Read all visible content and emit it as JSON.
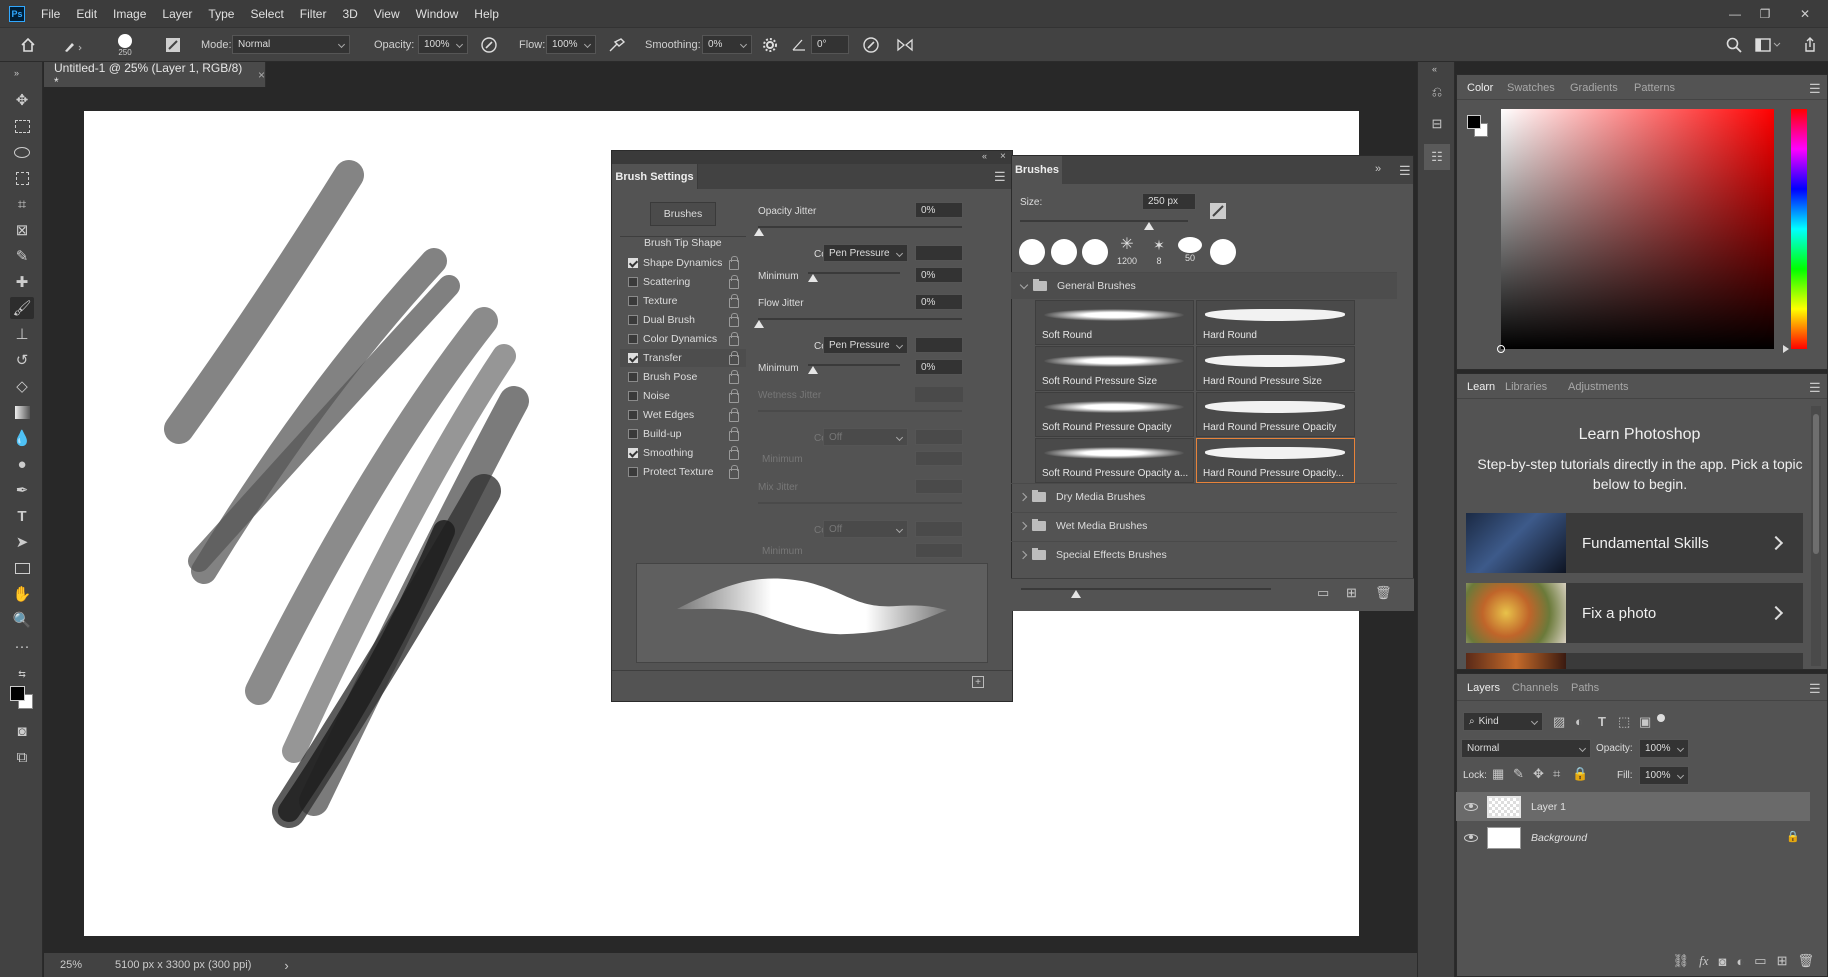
{
  "app": {
    "logo": "Ps"
  },
  "menu": [
    "File",
    "Edit",
    "Image",
    "Layer",
    "Type",
    "Select",
    "Filter",
    "3D",
    "View",
    "Window",
    "Help"
  ],
  "window_controls": {
    "minimize": "—",
    "restore": "❐",
    "close": "✕"
  },
  "options": {
    "brush_size": "250",
    "mode_label": "Mode:",
    "mode_value": "Normal",
    "opacity_label": "Opacity:",
    "opacity_value": "100%",
    "flow_label": "Flow:",
    "flow_value": "100%",
    "smoothing_label": "Smoothing:",
    "smoothing_value": "0%",
    "angle_value": "0°"
  },
  "document": {
    "tab_title": "Untitled-1 @ 25% (Layer 1, RGB/8) *",
    "close": "×"
  },
  "status": {
    "zoom": "25%",
    "doc_info": "5100 px x 3300 px (300 ppi)",
    "arrow": "›"
  },
  "brush_settings": {
    "title": "Brush Settings",
    "brushes_button": "Brushes",
    "tip_shape": "Brush Tip Shape",
    "options": [
      {
        "label": "Shape Dynamics",
        "checked": true
      },
      {
        "label": "Scattering",
        "checked": false
      },
      {
        "label": "Texture",
        "checked": false
      },
      {
        "label": "Dual Brush",
        "checked": false
      },
      {
        "label": "Color Dynamics",
        "checked": false
      },
      {
        "label": "Transfer",
        "checked": true
      },
      {
        "label": "Brush Pose",
        "checked": false
      },
      {
        "label": "Noise",
        "checked": false
      },
      {
        "label": "Wet Edges",
        "checked": false
      },
      {
        "label": "Build-up",
        "checked": false
      },
      {
        "label": "Smoothing",
        "checked": true
      },
      {
        "label": "Protect Texture",
        "checked": false
      }
    ],
    "opacity_jitter": {
      "label": "Opacity Jitter",
      "value": "0%"
    },
    "control1": {
      "label": "Control:",
      "value": "Pen Pressure"
    },
    "minimum1": {
      "label": "Minimum",
      "value": "0%"
    },
    "flow_jitter": {
      "label": "Flow Jitter",
      "value": "0%"
    },
    "control2": {
      "label": "Control:",
      "value": "Pen Pressure"
    },
    "minimum2": {
      "label": "Minimum",
      "value": "0%"
    },
    "wetness_jitter": "Wetness Jitter",
    "control3": {
      "label": "Control:",
      "value": "Off"
    },
    "minimum3": "Minimum",
    "mix_jitter": "Mix Jitter",
    "control4": {
      "label": "Control:",
      "value": "Off"
    },
    "minimum4": "Minimum"
  },
  "brushes": {
    "title": "Brushes",
    "size_label": "Size:",
    "size_value": "250 px",
    "tip_counts": [
      "1200",
      "8",
      "50"
    ],
    "general_group": "General Brushes",
    "presets": [
      {
        "name": "Soft Round",
        "hard": false
      },
      {
        "name": "Hard Round",
        "hard": true
      },
      {
        "name": "Soft Round Pressure Size",
        "hard": false
      },
      {
        "name": "Hard Round Pressure Size",
        "hard": true
      },
      {
        "name": "Soft Round Pressure Opacity",
        "hard": false
      },
      {
        "name": "Hard Round Pressure Opacity",
        "hard": true
      },
      {
        "name": "Soft Round Pressure Opacity a...",
        "hard": false
      },
      {
        "name": "Hard Round Pressure Opacity...",
        "hard": true
      }
    ],
    "groups": [
      "Dry Media Brushes",
      "Wet Media Brushes",
      "Special Effects Brushes"
    ]
  },
  "color_panel": {
    "tabs": [
      "Color",
      "Swatches",
      "Gradients",
      "Patterns"
    ]
  },
  "learn_panel": {
    "tabs": [
      "Learn",
      "Libraries",
      "Adjustments"
    ],
    "title": "Learn Photoshop",
    "subtitle": "Step-by-step tutorials directly in the app. Pick a topic below to begin.",
    "cards": [
      "Fundamental Skills",
      "Fix a photo"
    ]
  },
  "layers_panel": {
    "tabs": [
      "Layers",
      "Channels",
      "Paths"
    ],
    "kind": "Kind",
    "blend": "Normal",
    "opacity_label": "Opacity:",
    "opacity_value": "100%",
    "lock_label": "Lock:",
    "fill_label": "Fill:",
    "fill_value": "100%",
    "layers": [
      {
        "name": "Layer 1",
        "italic": false
      },
      {
        "name": "Background",
        "italic": true
      }
    ]
  },
  "colors": {
    "accent": "#31a8ff",
    "selected_border": "#e8833a",
    "panel": "#535353",
    "toolbar": "#424242"
  }
}
